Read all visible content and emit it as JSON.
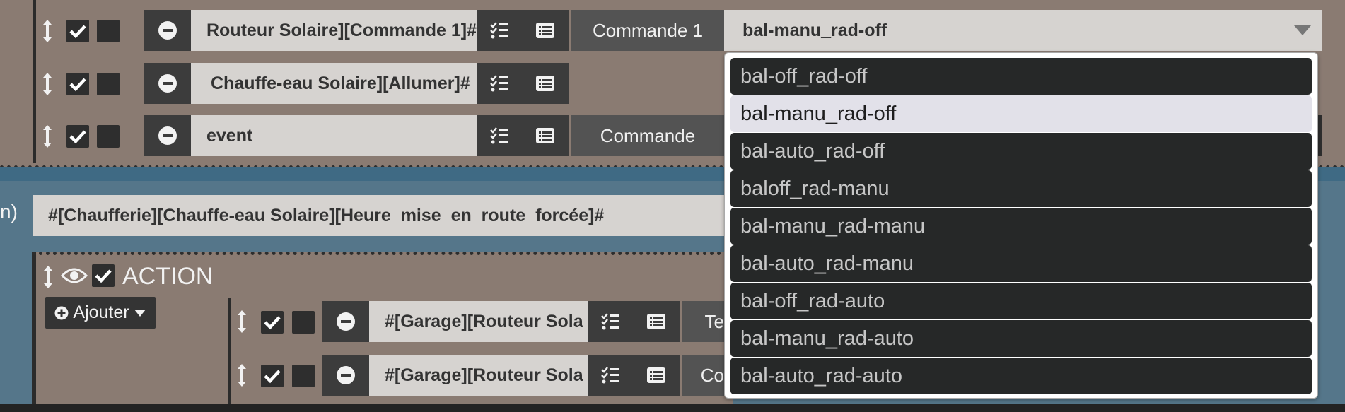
{
  "rows": [
    {
      "field": "Routeur Solaire][Commande 1]#",
      "label": "Commande 1",
      "select_value": "bal-manu_rad-off"
    },
    {
      "field": "Chauffe-eau Solaire][Allumer]#"
    },
    {
      "field": "event",
      "label": "Commande"
    }
  ],
  "condition": {
    "left_label": "n)",
    "expression": "#[Chaufferie][Chauffe-eau Solaire][Heure_mise_en_route_forcée]#"
  },
  "action_block": {
    "title": "ACTION",
    "add_button": "Ajouter",
    "rows": [
      {
        "field": "#[Garage][Routeur Sola",
        "label": "Te"
      },
      {
        "field": "#[Garage][Routeur Sola",
        "label": "Co"
      }
    ]
  },
  "dropdown": {
    "selected_index": 1,
    "options": [
      "bal-off_rad-off",
      "bal-manu_rad-off",
      "bal-auto_rad-off",
      "baloff_rad-manu",
      "bal-manu_rad-manu",
      "bal-auto_rad-manu",
      "bal-off_rad-auto",
      "bal-manu_rad-auto",
      "bal-auto_rad-auto"
    ]
  },
  "colors": {
    "brown_bg": "#8a7b72",
    "blue_bg": "#55768a",
    "dark_button": "#3c3c3c",
    "field_bg": "#d6d3d0"
  },
  "icons": [
    "move-handle-icon",
    "checkbox-checked-icon",
    "minus-circle-icon",
    "task-list-icon",
    "list-alt-icon",
    "eye-icon",
    "plus-circle-icon",
    "caret-down-icon"
  ]
}
